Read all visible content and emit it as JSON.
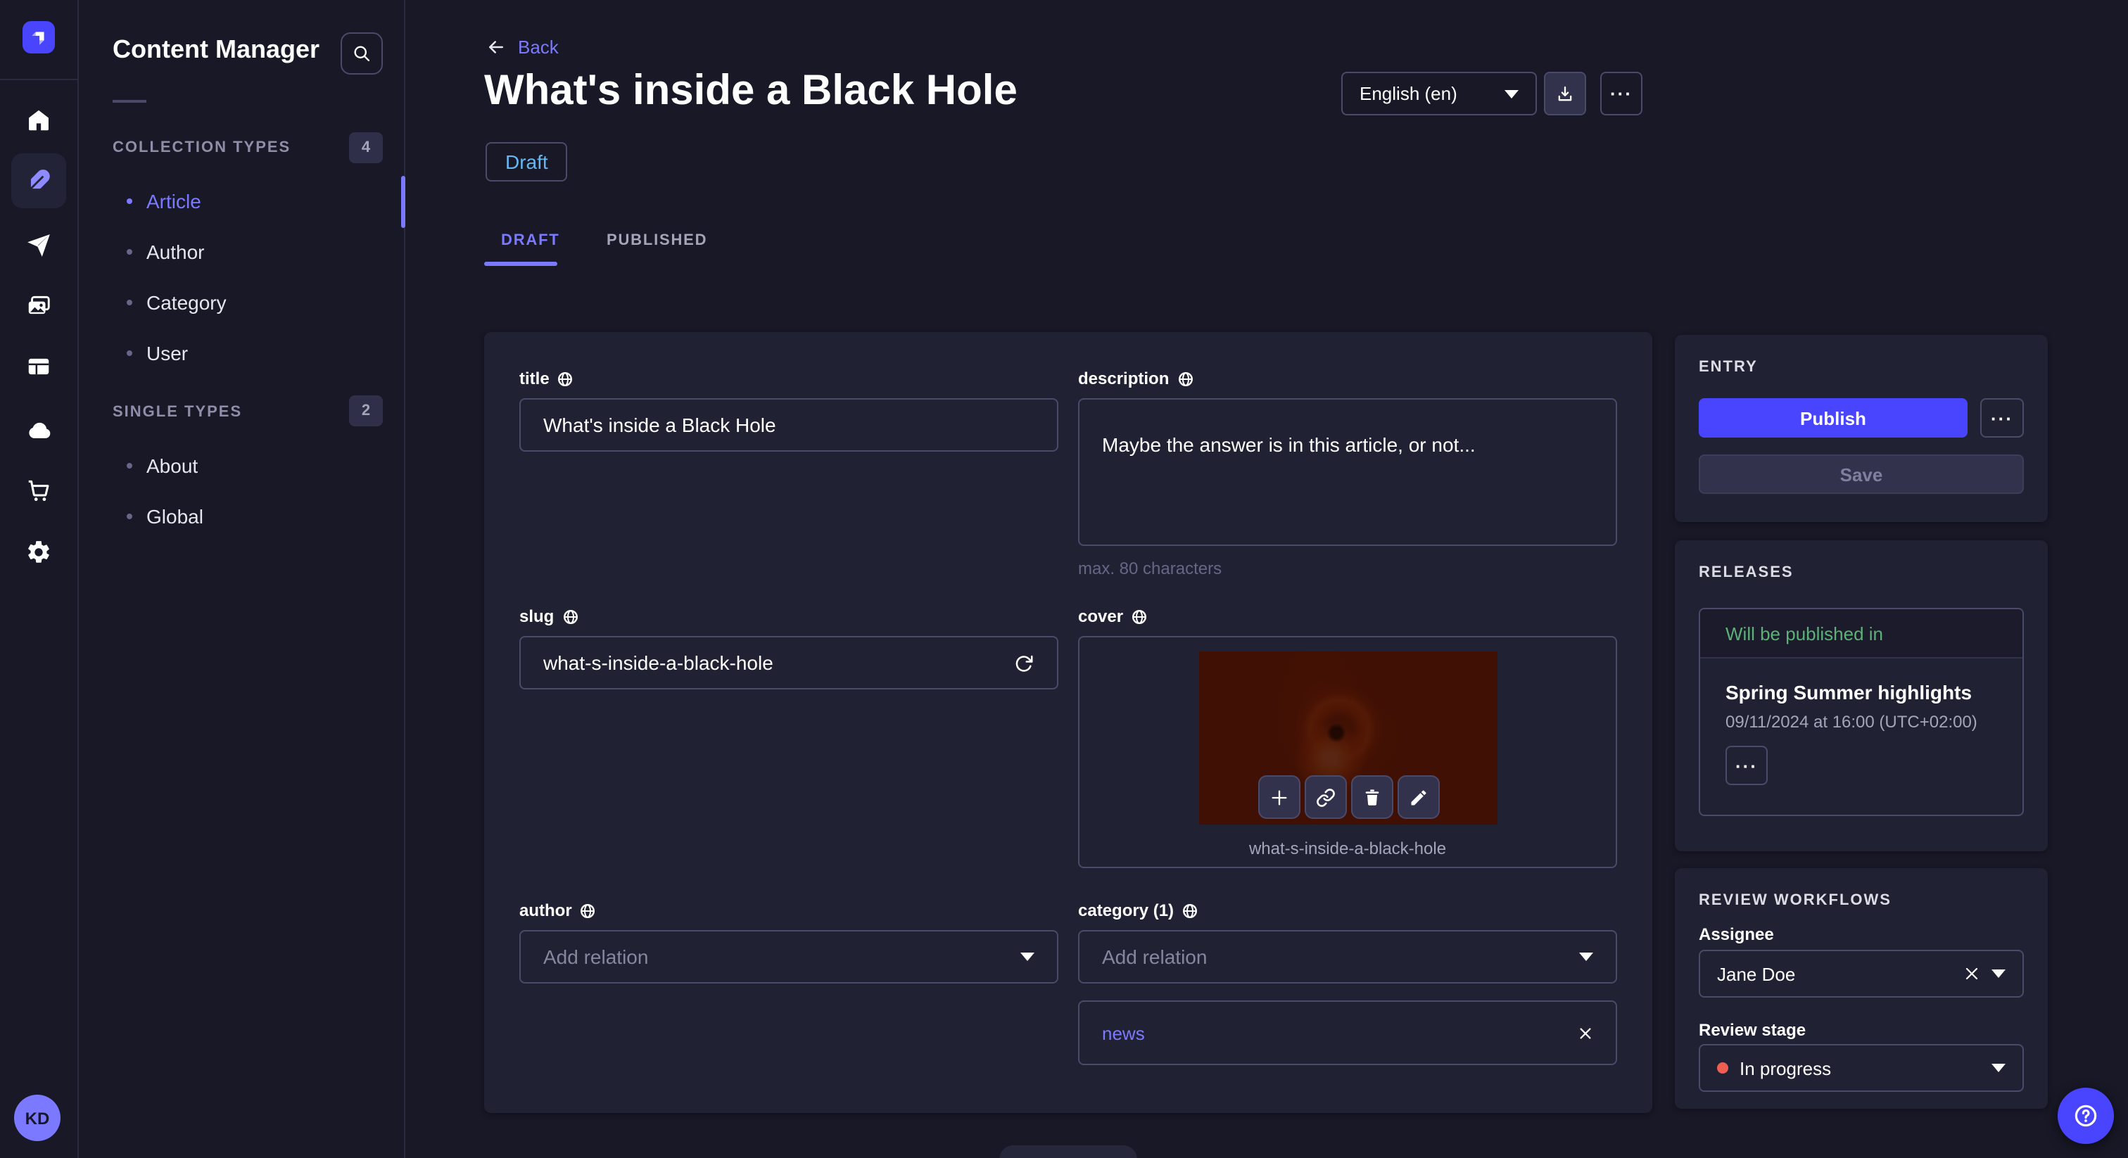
{
  "colors": {
    "primary": "#4945ff",
    "accent": "#7b79ff",
    "draft_blue": "#66b7f1",
    "success_green": "#5cb176",
    "danger_red": "#ee5e52",
    "page_bg": "#181826",
    "panel_bg": "#212134"
  },
  "rail": {
    "avatar_initials": "KD"
  },
  "sidebar": {
    "title": "Content Manager",
    "sections": [
      {
        "label": "COLLECTION TYPES",
        "count": "4",
        "items": [
          {
            "label": "Article"
          },
          {
            "label": "Author"
          },
          {
            "label": "Category"
          },
          {
            "label": "User"
          }
        ]
      },
      {
        "label": "SINGLE TYPES",
        "count": "2",
        "items": [
          {
            "label": "About"
          },
          {
            "label": "Global"
          }
        ]
      }
    ]
  },
  "header": {
    "back_label": "Back",
    "title": "What's inside a Black Hole",
    "status_badge": "Draft",
    "tabs": [
      {
        "label": "DRAFT"
      },
      {
        "label": "PUBLISHED"
      }
    ],
    "locale": "English (en)",
    "more_label": "···"
  },
  "form": {
    "title": {
      "label": "title",
      "value": "What's inside a Black Hole"
    },
    "description": {
      "label": "description",
      "value": "Maybe the answer is in this article, or not...",
      "helper": "max. 80 characters"
    },
    "slug": {
      "label": "slug",
      "value": "what-s-inside-a-black-hole"
    },
    "cover": {
      "label": "cover",
      "caption": "what-s-inside-a-black-hole"
    },
    "author": {
      "label": "author",
      "placeholder": "Add relation"
    },
    "category": {
      "label": "category (1)",
      "placeholder": "Add relation",
      "relation": "news"
    }
  },
  "entry": {
    "label": "ENTRY",
    "publish_label": "Publish",
    "save_label": "Save",
    "more_label": "···"
  },
  "releases": {
    "label": "RELEASES",
    "card_header": "Will be published in",
    "release_name": "Spring Summer highlights",
    "release_date": "09/11/2024 at 16:00 (UTC+02:00)",
    "more_label": "···"
  },
  "review": {
    "label": "REVIEW WORKFLOWS",
    "assignee_label": "Assignee",
    "assignee_value": "Jane Doe",
    "stage_label": "Review stage",
    "stage_value": "In progress"
  }
}
